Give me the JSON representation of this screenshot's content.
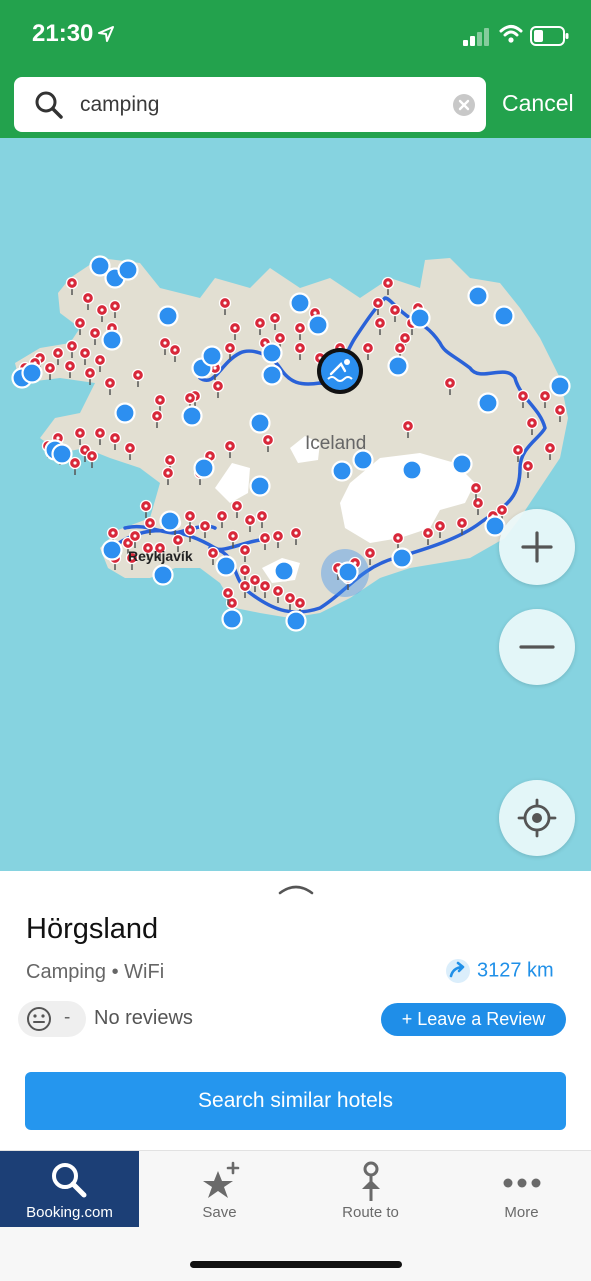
{
  "status_bar": {
    "time": "21:30"
  },
  "search": {
    "value": "camping",
    "cancel_label": "Cancel"
  },
  "map": {
    "country_label": "Iceland",
    "city_label": "Reykjavík"
  },
  "place": {
    "name": "Hörgsland",
    "tags": "Camping • WiFi",
    "distance": "3127 km",
    "rating": "-",
    "reviews_text": "No reviews",
    "leave_review_label": "+ Leave a Review",
    "cta_label": "Search similar hotels"
  },
  "tabs": [
    {
      "label": "Booking.com",
      "icon": "search-icon",
      "active": true
    },
    {
      "label": "Save",
      "icon": "star-plus-icon"
    },
    {
      "label": "Route to",
      "icon": "route-icon"
    },
    {
      "label": "More",
      "icon": "more-icon"
    }
  ],
  "colors": {
    "header_green": "#23a24d",
    "water": "#86d3e0",
    "land": "#e2dfd2",
    "pin_red": "#d8283a",
    "marker_blue": "#2d8ff0",
    "tab_active": "#1c3f76"
  }
}
